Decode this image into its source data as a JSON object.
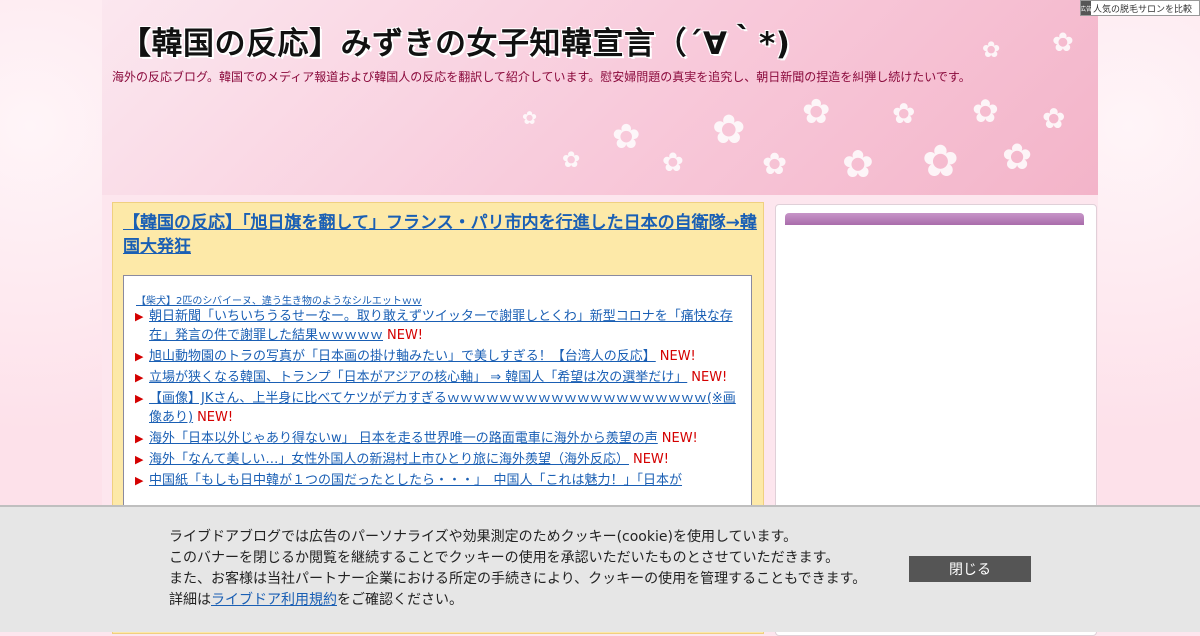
{
  "header": {
    "title": "【韓国の反応】みずきの女子知韓宣言（´∀｀*)",
    "description": "海外の反応ブログ。韓国でのメディア報道および韓国人の反応を翻訳して紹介しています。慰安婦問題の真実を追究し、朝日新聞の捏造を糾弾し続けたいです。"
  },
  "ad_badge": {
    "mark": "広告",
    "label": "人気の脱毛サロンを比較"
  },
  "post": {
    "title": "【韓国の反応】「旭日旗を翻して」フランス・パリ市内を行進した日本の自衛隊→韓国大発狂"
  },
  "related": {
    "top_link": "【柴犬】2匹のシバイーヌ、違う生き物のようなシルエットｗｗ",
    "new_label": "NEW!",
    "items": [
      {
        "text": "朝日新聞「いちいちうるせーなー。取り敢えずツイッターで謝罪しとくわ」新型コロナを「痛快な存在」発言の件で謝罪した結果ｗｗｗｗｗ",
        "new": "NEW!"
      },
      {
        "text": "旭山動物園のトラの写真が「日本画の掛け軸みたい」で美しすぎる！【台湾人の反応】",
        "new": "NEW!"
      },
      {
        "text": "立場が狭くなる韓国、トランプ「日本がアジアの核心軸」 ⇒ 韓国人「希望は次の選挙だけ」",
        "new": "NEW!"
      },
      {
        "text": "【画像】JKさん、上半身に比べてケツがデカすぎるｗｗｗｗｗｗｗｗｗｗｗｗｗｗｗｗｗｗｗｗ(※画像あり)",
        "new": "NEW!"
      },
      {
        "text": "海外「日本以外じゃあり得ないw」 日本を走る世界唯一の路面電車に海外から羨望の声",
        "new": "NEW!"
      },
      {
        "text": "海外「なんて美しい…」女性外国人の新潟村上市ひとり旅に海外羨望（海外反応）",
        "new": "NEW!"
      },
      {
        "text": "中国紙「もしも日中韓が１つの国だったとしたら・・・」　中国人「これは魅力！」「日本が",
        "new": ""
      }
    ]
  },
  "cookie": {
    "line1": "ライブドアブログでは広告のパーソナライズや効果測定のためクッキー(cookie)を使用しています。",
    "line2": "このバナーを閉じるか閲覧を継続することでクッキーの使用を承認いただいたものとさせていただきます。",
    "line3": "また、お客様は当社パートナー企業における所定の手続きにより、クッキーの使用を管理することもできます。",
    "line4_prefix": "詳細は",
    "line4_link": "ライブドア利用規約",
    "line4_suffix": "をご確認ください。",
    "close_label": "閉じる"
  }
}
